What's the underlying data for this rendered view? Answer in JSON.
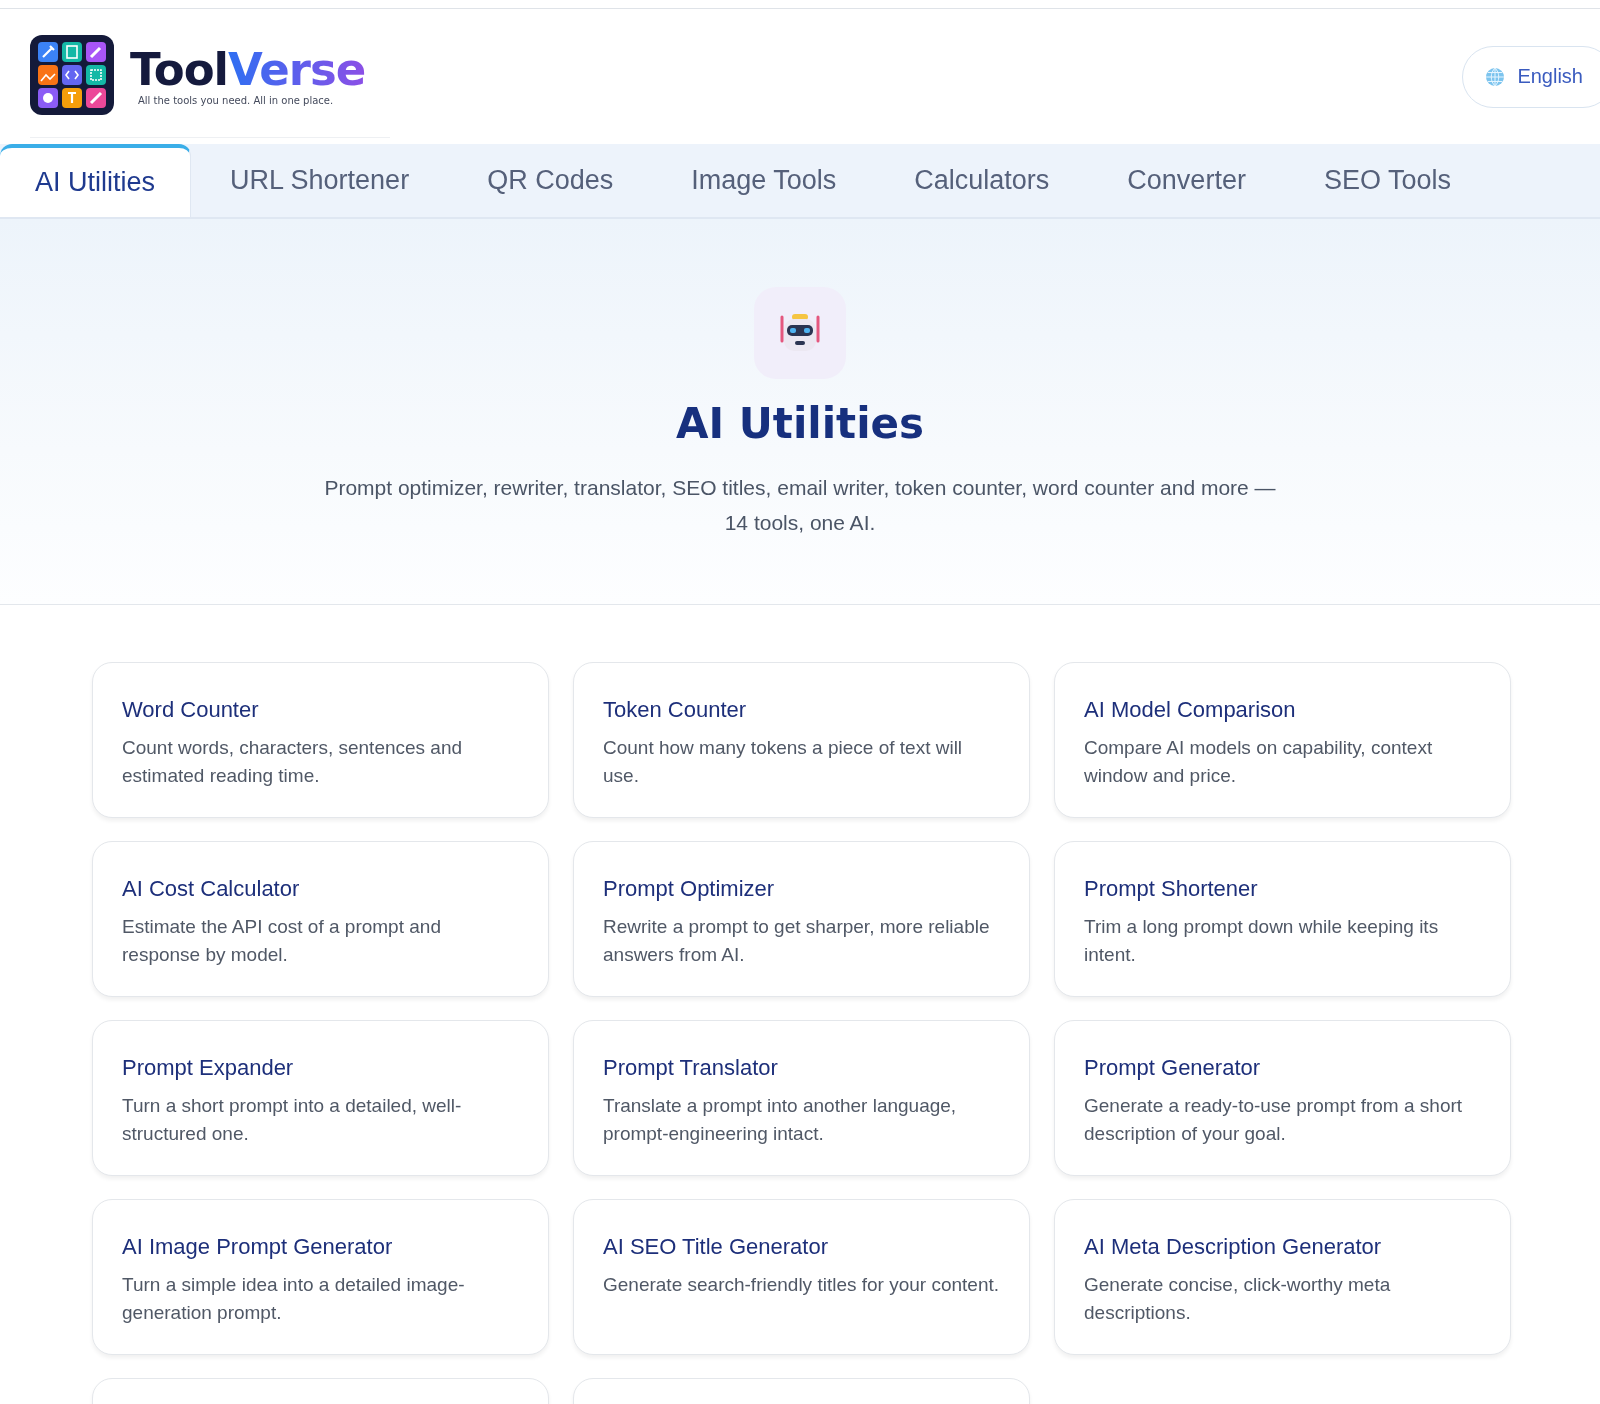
{
  "brand": {
    "name_first": "Tool",
    "name_second": "Verse",
    "tagline": "All the tools you need. All in one place."
  },
  "language_button": {
    "label": "English"
  },
  "tabs": [
    {
      "label": "AI Utilities",
      "selected": true
    },
    {
      "label": "URL Shortener",
      "selected": false
    },
    {
      "label": "QR Codes",
      "selected": false
    },
    {
      "label": "Image Tools",
      "selected": false
    },
    {
      "label": "Calculators",
      "selected": false
    },
    {
      "label": "Converter",
      "selected": false
    },
    {
      "label": "SEO Tools",
      "selected": false
    }
  ],
  "hero": {
    "title": "AI Utilities",
    "subtitle": "Prompt optimizer, rewriter, translator, SEO titles, email writer, token counter, word counter and more — 14 tools, one AI."
  },
  "cards": [
    {
      "kind": "tool",
      "title": "Word Counter",
      "description": "Count words, characters, sentences and estimated reading time."
    },
    {
      "kind": "tool",
      "title": "Token Counter",
      "description": "Count how many tokens a piece of text will use."
    },
    {
      "kind": "tool",
      "title": "AI Model Comparison",
      "description": "Compare AI models on capability, context window and price."
    },
    {
      "kind": "tool",
      "title": "AI Cost Calculator",
      "description": "Estimate the API cost of a prompt and response by model."
    },
    {
      "kind": "tool",
      "title": "Prompt Optimizer",
      "description": "Rewrite a prompt to get sharper, more reliable answers from AI."
    },
    {
      "kind": "tool",
      "title": "Prompt Shortener",
      "description": "Trim a long prompt down while keeping its intent."
    },
    {
      "kind": "tool",
      "title": "Prompt Expander",
      "description": "Turn a short prompt into a detailed, well-structured one."
    },
    {
      "kind": "tool",
      "title": "Prompt Translator",
      "description": "Translate a prompt into another language, prompt-engineering intact."
    },
    {
      "kind": "tool",
      "title": "Prompt Generator",
      "description": "Generate a ready-to-use prompt from a short description of your goal."
    },
    {
      "kind": "tool",
      "title": "AI Image Prompt Generator",
      "description": "Turn a simple idea into a detailed image-generation prompt."
    },
    {
      "kind": "tool",
      "title": "AI SEO Title Generator",
      "description": "Generate search-friendly titles for your content."
    },
    {
      "kind": "tool",
      "title": "AI Meta Description Generator",
      "description": "Generate concise, click-worthy meta descriptions."
    },
    {
      "kind": "cut_off"
    },
    {
      "kind": "cut_off"
    }
  ]
}
